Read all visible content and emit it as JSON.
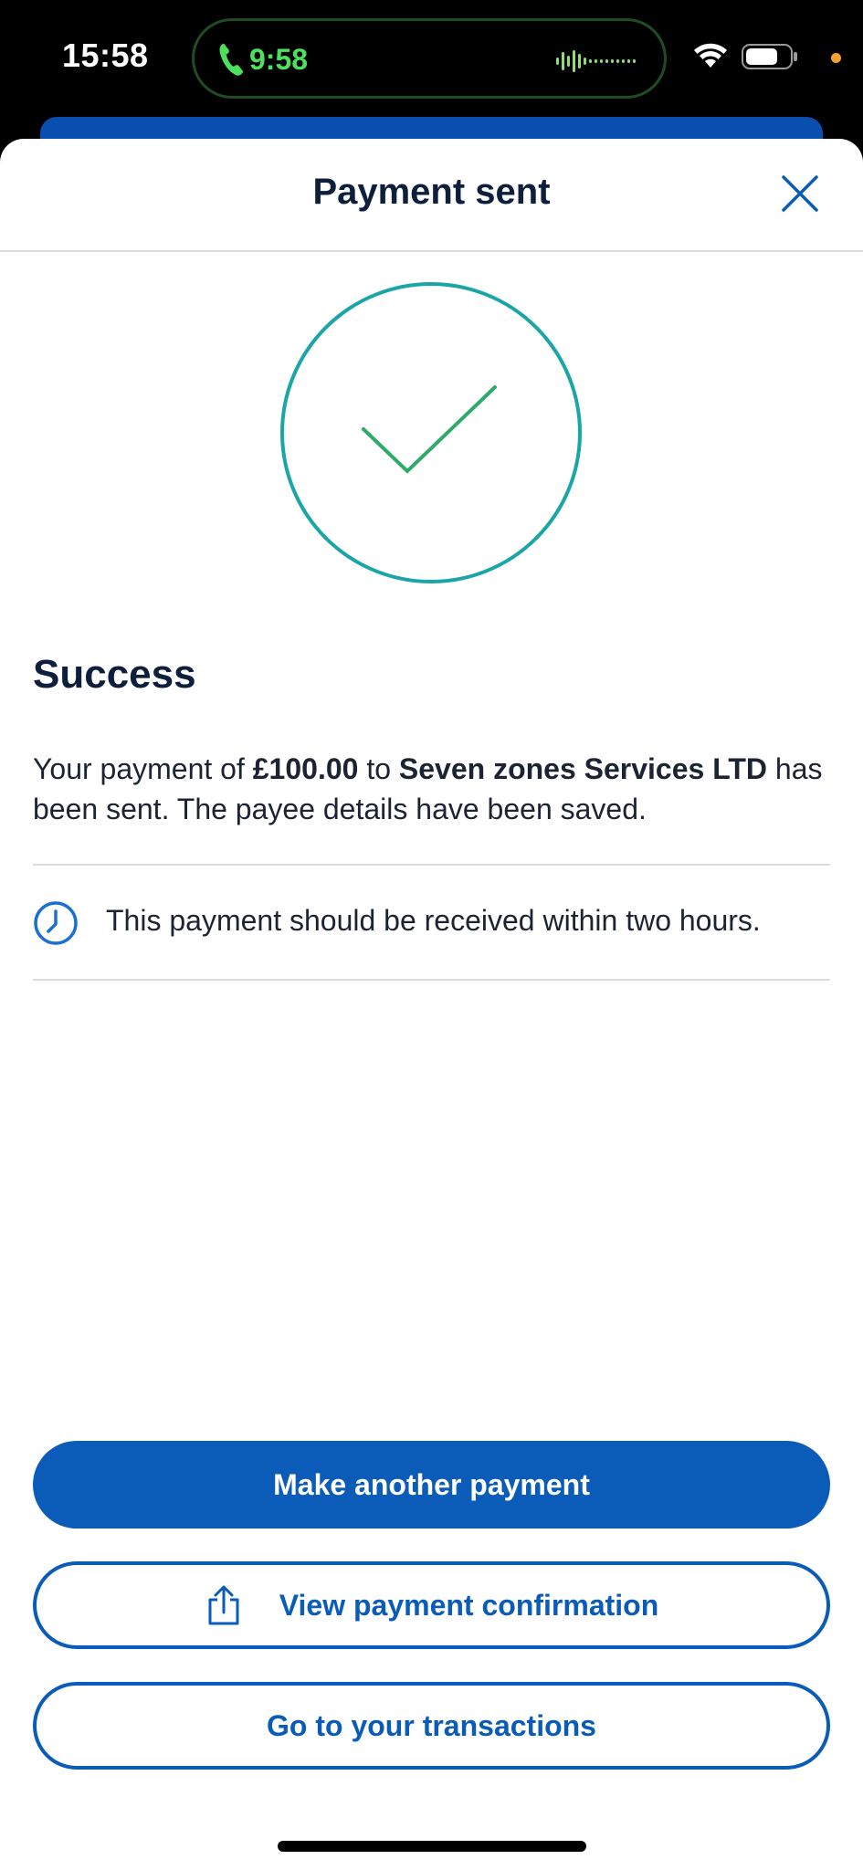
{
  "status_bar": {
    "time": "15:58",
    "call_time": "9:58"
  },
  "sheet": {
    "title": "Payment sent"
  },
  "success": {
    "heading": "Success",
    "message_prefix": "Your payment of ",
    "amount": "£100.00",
    "message_middle": " to ",
    "payee": "Seven zones Services LTD",
    "message_suffix": " has been sent. The payee details have been saved."
  },
  "info": {
    "text": "This payment should be received within two hours."
  },
  "buttons": {
    "make_another": "Make another payment",
    "view_confirmation": "View payment confirmation",
    "go_transactions": "Go to your transactions"
  },
  "colors": {
    "primary": "#0a5cb8",
    "success_circle": "#1aa6a6",
    "checkmark": "#2eaa6a",
    "call_green": "#4ce05f"
  },
  "icons": {
    "close": "close-icon",
    "success": "checkmark-icon",
    "clock": "clock-icon",
    "share": "share-icon"
  }
}
